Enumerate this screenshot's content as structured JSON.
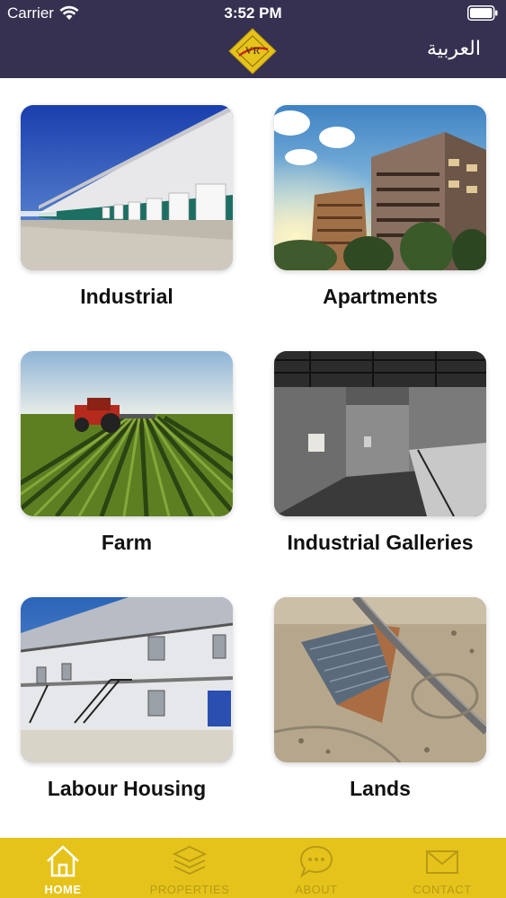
{
  "status_bar": {
    "carrier": "Carrier",
    "time": "3:52 PM"
  },
  "header": {
    "language_toggle": "العربية",
    "logo_text": "VR"
  },
  "categories": [
    {
      "label": "Industrial"
    },
    {
      "label": "Apartments"
    },
    {
      "label": "Farm"
    },
    {
      "label": "Industrial Galleries"
    },
    {
      "label": "Labour Housing"
    },
    {
      "label": "Lands"
    }
  ],
  "tabs": [
    {
      "label": "HOME",
      "icon": "home-icon",
      "active": true
    },
    {
      "label": "PROPERTIES",
      "icon": "layers-icon",
      "active": false
    },
    {
      "label": "ABOUT",
      "icon": "chat-bubble-icon",
      "active": false
    },
    {
      "label": "CONTACT",
      "icon": "envelope-icon",
      "active": false
    }
  ],
  "colors": {
    "header": "#363150",
    "tabbar": "#e6c31a",
    "tab_inactive": "#b79a18",
    "tab_active": "#ffffff"
  }
}
